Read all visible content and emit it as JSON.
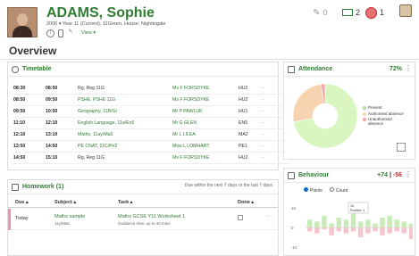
{
  "student": {
    "name": "ADAMS, Sophie",
    "meta": "2006 ▾  Year 11 (Current), 11Green, House: Nightingale",
    "view": "View ▾"
  },
  "badges": {
    "edit": "0",
    "messages": "2",
    "alerts": "1"
  },
  "page": {
    "title": "Overview"
  },
  "timetable": {
    "title": "Timetable",
    "rows": [
      {
        "start": "08:30",
        "end": "08:50",
        "subject": "Rg, Reg 11G",
        "teacher": "Ms F FORSDYKE",
        "room": "HU2"
      },
      {
        "start": "08:50",
        "end": "09:50",
        "subject": "PSHE, PSHE 11G",
        "teacher": "Ms F FORSDYKE",
        "room": "HU2"
      },
      {
        "start": "09:50",
        "end": "10:50",
        "subject": "Geography, 11B/Gr",
        "teacher": "Mr P PAWLUK",
        "room": "HU1"
      },
      {
        "start": "11:10",
        "end": "12:10",
        "subject": "English Language, 11a/En5",
        "teacher": "Mr G GLEN",
        "room": "EN5"
      },
      {
        "start": "12:10",
        "end": "13:10",
        "subject": "Maths, 11ay/Ma5",
        "teacher": "Mr L LILEA",
        "room": "MA2"
      },
      {
        "start": "13:50",
        "end": "14:50",
        "subject": "PE CNAT, 11C/Pe2",
        "teacher": "Miss L LOMHART",
        "room": "PE1"
      },
      {
        "start": "14:50",
        "end": "15:10",
        "subject": "Rg, Reg 11G",
        "teacher": "Ms F FORSDYKE",
        "room": "HU2"
      }
    ],
    "more": "···"
  },
  "homework": {
    "title": "Homework (1)",
    "note": "Due within the next 7 days or the last 7 days",
    "headers": [
      "Due ▴",
      "Subject ▴",
      "Task ▴",
      "Done ▴"
    ],
    "rows": [
      {
        "due": "Today",
        "subject": "Maths sample",
        "subject2": "11y/Ma5",
        "task": "Maths GCSE Y11 Worksheet 1",
        "task2": "Guidance time: up to 40 mins"
      }
    ]
  },
  "attendance": {
    "title": "Attendance",
    "pct": "72%",
    "legend": [
      "Present",
      "Authorised absence",
      "Unauthorised absence"
    ],
    "colors": [
      "#d9f5c0",
      "#f7d3b0",
      "#f3a5b0"
    ]
  },
  "behaviour": {
    "title": "Behaviour",
    "score_pos": "+74",
    "sep": " | ",
    "score_neg": "-56",
    "opt_points": "Points",
    "opt_count": "Count",
    "y_top": "10",
    "y_mid": "0",
    "y_bot": "-10",
    "tooltip_date": "16",
    "tooltip_val": "Positive: 4"
  },
  "chart_data": {
    "type": "pie",
    "labels": [
      "Present",
      "Authorised absence",
      "Unauthorised absence"
    ],
    "values": [
      72,
      26,
      2
    ],
    "colors": [
      "#d9f5c0",
      "#f7d3b0",
      "#f3a5b0"
    ]
  }
}
